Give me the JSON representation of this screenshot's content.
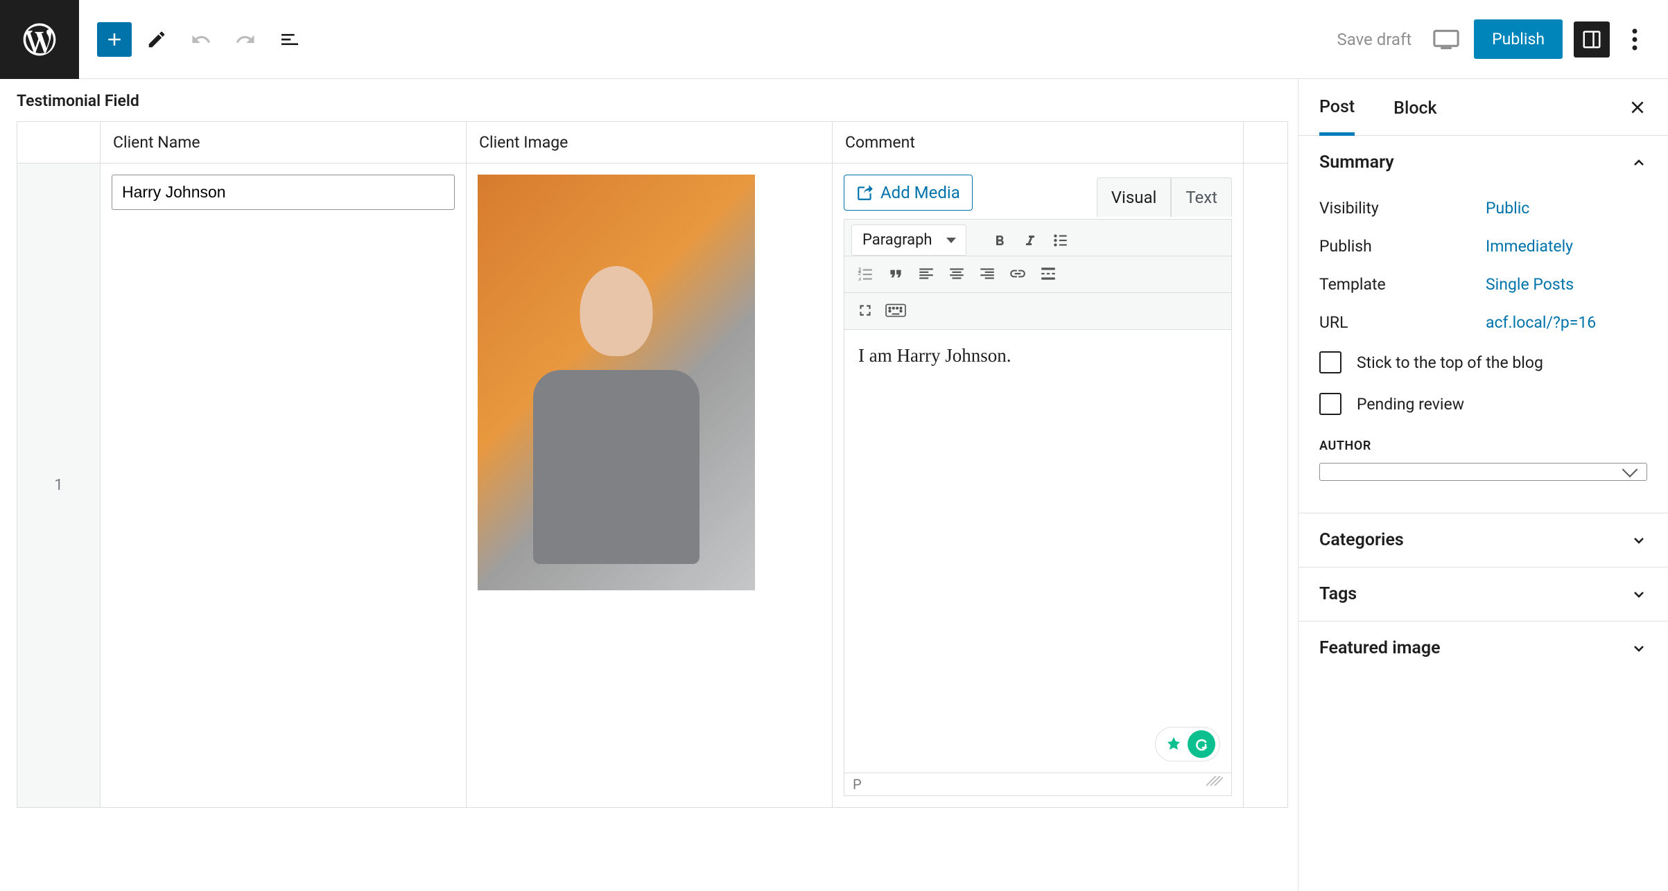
{
  "toolbar": {
    "save_draft": "Save draft",
    "publish": "Publish"
  },
  "field": {
    "title": "Testimonial Field",
    "columns": {
      "name": "Client Name",
      "image": "Client Image",
      "comment": "Comment"
    },
    "row_number": "1",
    "client_name": "Harry Johnson"
  },
  "editor": {
    "add_media": "Add Media",
    "tab_visual": "Visual",
    "tab_text": "Text",
    "format": "Paragraph",
    "content": "I am Harry Johnson.",
    "status_path": "P"
  },
  "sidebar": {
    "tab_post": "Post",
    "tab_block": "Block",
    "summary": {
      "title": "Summary",
      "visibility_label": "Visibility",
      "visibility_value": "Public",
      "publish_label": "Publish",
      "publish_value": "Immediately",
      "template_label": "Template",
      "template_value": "Single Posts",
      "url_label": "URL",
      "url_value": "acf.local/?p=16",
      "stick_label": "Stick to the top of the blog",
      "pending_label": "Pending review",
      "author_heading": "AUTHOR",
      "author_value": " "
    },
    "categories": "Categories",
    "tags": "Tags",
    "featured_image": "Featured image"
  }
}
